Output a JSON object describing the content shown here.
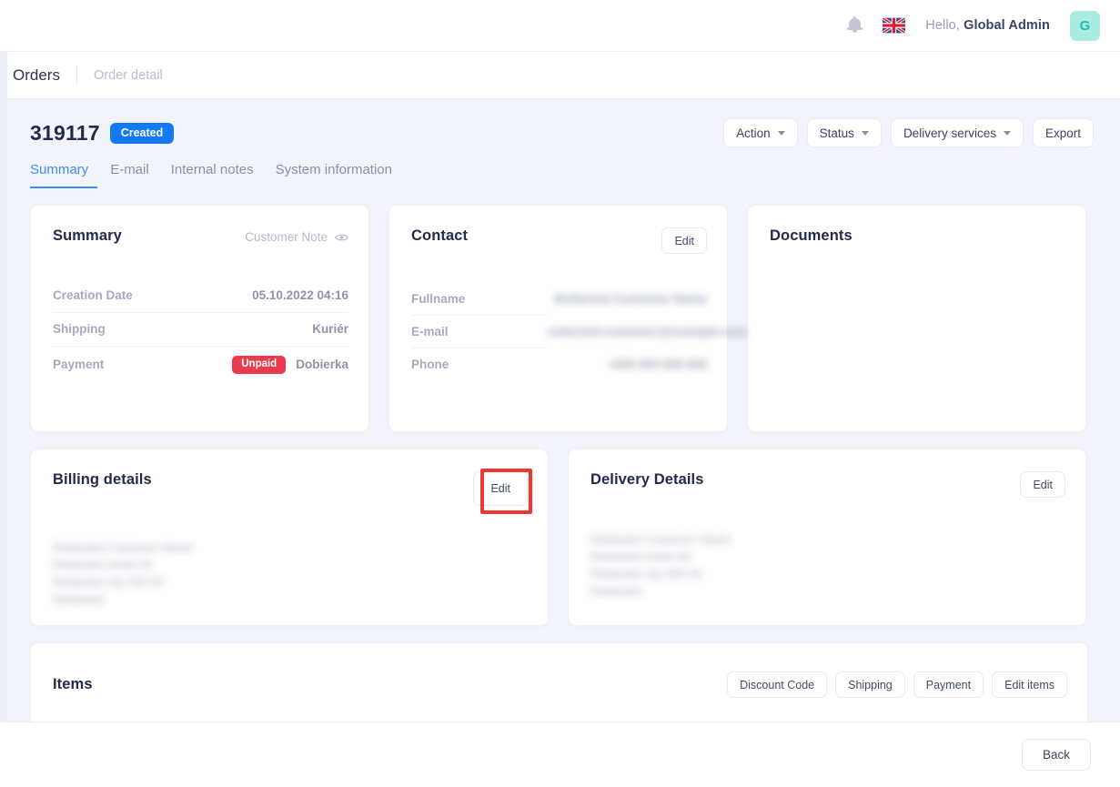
{
  "topbar": {
    "bell_icon": "bell-icon",
    "flag": "uk-flag-icon",
    "greeting_prefix": "Hello,",
    "user_name": "Global Admin",
    "avatar_initial": "G"
  },
  "breadcrumb": {
    "main": "Orders",
    "sub": "Order detail"
  },
  "order": {
    "id": "319117",
    "status_badge": "Created"
  },
  "header_actions": [
    {
      "label": "Action",
      "has_caret": true
    },
    {
      "label": "Status",
      "has_caret": true
    },
    {
      "label": "Delivery services",
      "has_caret": true
    },
    {
      "label": "Export",
      "has_caret": false
    }
  ],
  "tabs": [
    {
      "label": "Summary",
      "active": true
    },
    {
      "label": "E-mail",
      "active": false
    },
    {
      "label": "Internal notes",
      "active": false
    },
    {
      "label": "System information",
      "active": false
    }
  ],
  "summary_card": {
    "title": "Summary",
    "customer_note_label": "Customer Note",
    "eye_icon": "eye-icon",
    "rows": [
      {
        "key": "Creation Date",
        "value": "05.10.2022 04:16",
        "pill": null
      },
      {
        "key": "Shipping",
        "value": "Kuriér",
        "pill": null
      },
      {
        "key": "Payment",
        "value": "Dobierka",
        "pill": "Unpaid"
      }
    ]
  },
  "contact_card": {
    "title": "Contact",
    "edit_label": "Edit",
    "rows": [
      {
        "key": "Fullname",
        "value": "Redacted Customer Name"
      },
      {
        "key": "E-mail",
        "value": "redacted.customer@example.com"
      },
      {
        "key": "Phone",
        "value": "+000 000 000 000"
      }
    ]
  },
  "documents_card": {
    "title": "Documents",
    "body": ""
  },
  "billing_card": {
    "title": "Billing details",
    "edit_label": "Edit",
    "address": "Redacted Customer Name\nRedacted street 00\nRedacted city 000 00\nRedacted"
  },
  "delivery_card": {
    "title": "Delivery Details",
    "edit_label": "Edit",
    "address": "Redacted Customer Name\nRedacted street 00\nRedacted city 000 00\nRedacted"
  },
  "items_card": {
    "title": "Items",
    "buttons": [
      {
        "label": "Discount Code"
      },
      {
        "label": "Shipping"
      },
      {
        "label": "Payment"
      },
      {
        "label": "Edit items"
      }
    ]
  },
  "footer": {
    "back_label": "Back"
  },
  "colors": {
    "accent_blue": "#3d8df7",
    "badge_blue": "#1479f5",
    "unpaid_red": "#e93a4e",
    "page_bg": "#f3f4fb",
    "avatar_bg": "#a9ece2",
    "annotation_red": "#f0372f"
  },
  "annotation": {
    "target": "billing-details-edit-button"
  }
}
